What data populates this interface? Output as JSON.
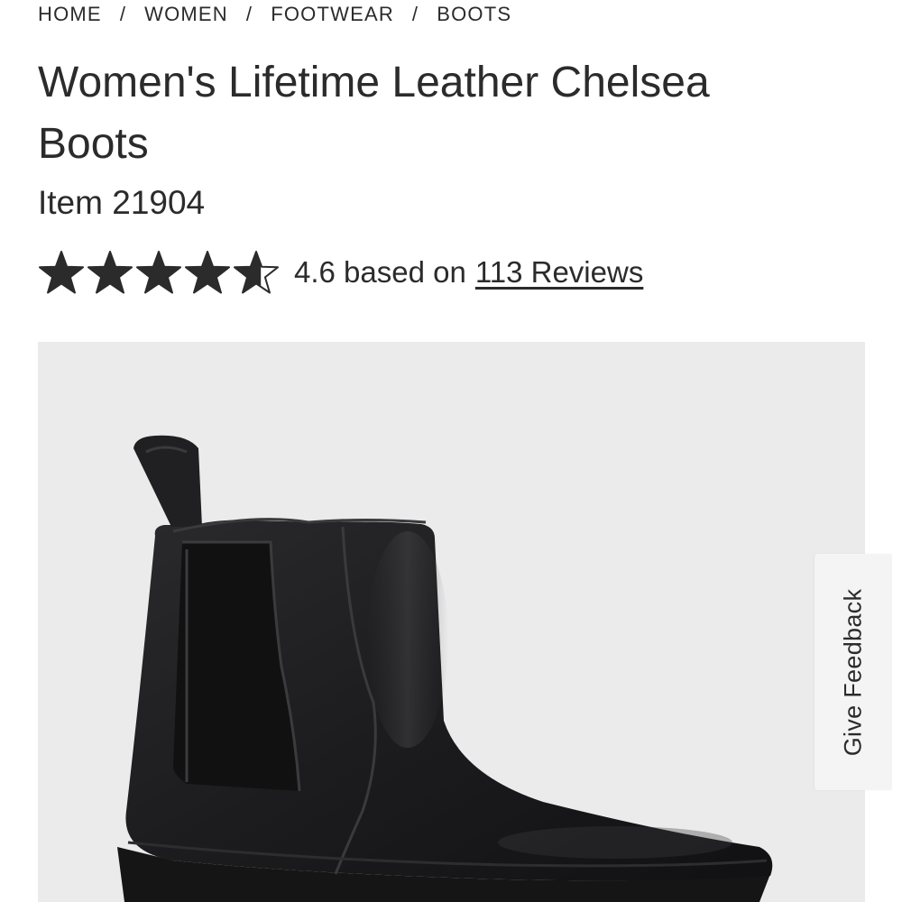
{
  "breadcrumb": {
    "items": [
      "HOME",
      "WOMEN",
      "FOOTWEAR",
      "BOOTS"
    ],
    "separator": "/"
  },
  "product": {
    "title": "Women's Lifetime Leather Chelsea Boots",
    "item_number": "Item 21904",
    "rating": {
      "value": 4.6,
      "max": 5,
      "text": "4.6 based on",
      "reviews_link": "113 Reviews"
    },
    "image": {
      "alt_icon": "black-chelsea-boot-photo",
      "background": "#ebebeb"
    }
  },
  "feedback": {
    "label": "Give Feedback"
  },
  "colors": {
    "text": "#2b2b2b",
    "star": "#2b2b2b",
    "image_bg": "#ebebeb",
    "feedback_bg": "#f4f4f4"
  }
}
